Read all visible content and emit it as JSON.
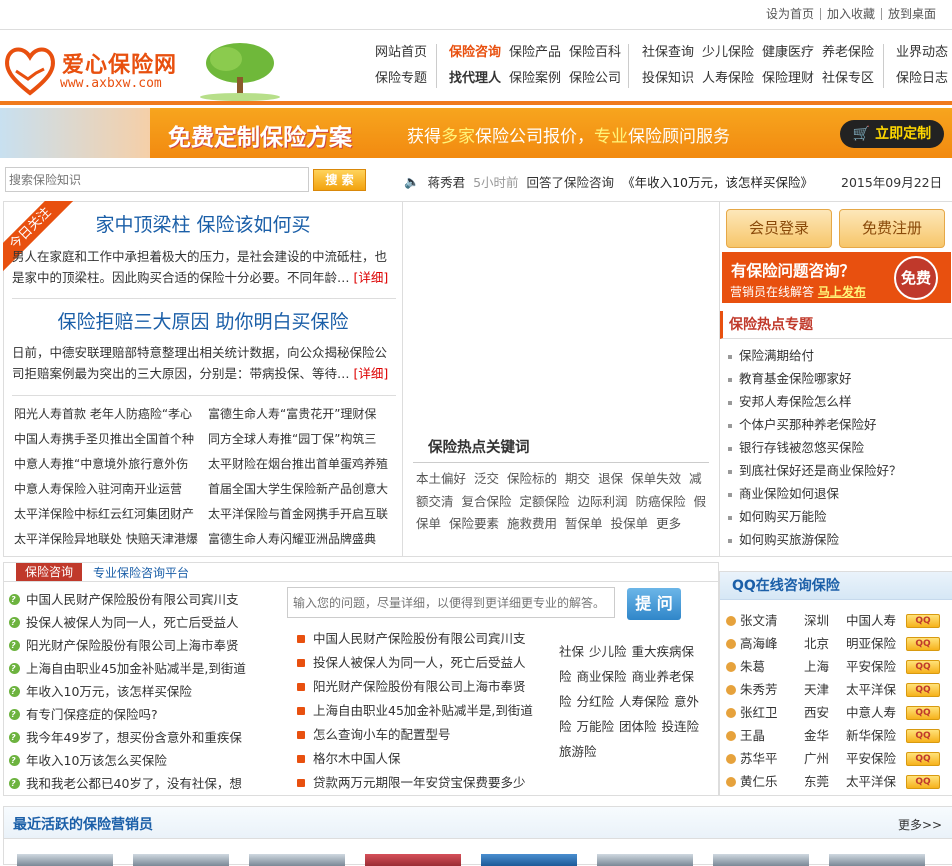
{
  "toplinks": [
    "设为首页",
    "加入收藏",
    "放到桌面"
  ],
  "logo": {
    "brand": "爱心保险网",
    "url": "www.axbxw.com"
  },
  "nav": {
    "g1": {
      "r1": [
        "网站首页"
      ],
      "r2": [
        "保险专题"
      ]
    },
    "g2": {
      "r1": [
        "保险咨询",
        "保险产品",
        "保险百科"
      ],
      "r2": [
        "找代理人",
        "保险案例",
        "保险公司"
      ]
    },
    "g3": {
      "r1": [
        "社保查询",
        "少儿保险",
        "健康医疗",
        "养老保险"
      ],
      "r2": [
        "投保知识",
        "人寿保险",
        "保险理财",
        "社保专区"
      ]
    },
    "g4": {
      "r1": [
        "业界动态"
      ],
      "r2": [
        "保险日志"
      ]
    }
  },
  "banner": {
    "t1": "免费定制保险方案",
    "t2a": "获得",
    "t2b": "多家",
    "t2c": "保险公司报价，",
    "t2d": "专业",
    "t2e": "保险顾问服务",
    "cta": "立即定制"
  },
  "search": {
    "placeholder": "搜索保险知识",
    "button": "搜 索"
  },
  "ticker": {
    "user": "蒋秀君",
    "time": "5小时前",
    "action": "回答了保险咨询",
    "question": "《年收入10万元，该怎样买保险》"
  },
  "date": "2015年09月22日",
  "focus": {
    "ribbon": "今日关注",
    "h1": "家中顶梁柱  保险该如何买",
    "p1": "男人在家庭和工作中承担着极大的压力，是社会建设的中流砥柱，也是家中的顶梁柱。因此购买合适的保险十分必要。不同年龄…",
    "h2": "保险拒赔三大原因  助你明白买保险",
    "p2": "日前，中德安联理赔部特意整理出相关统计数据，向公众揭秘保险公司拒赔案例最为突出的三大原因，分别是：带病投保、等待…",
    "more": "[详细]",
    "news": [
      [
        "阳光人寿首款 老年人防癌险“孝心",
        "富德生命人寿“富贵花开”理财保"
      ],
      [
        "中国人寿携手圣贝推出全国首个种",
        "同方全球人寿推“园丁保”构筑三"
      ],
      [
        "中意人寿推“中意境外旅行意外伤",
        "太平财险在烟台推出首单蛋鸡养殖"
      ],
      [
        "中意人寿保险入驻河南开业运营",
        "首届全国大学生保险新产品创意大"
      ],
      [
        "太平洋保险中标红云红河集团财产",
        "太平洋保险与首金网携手开启互联"
      ],
      [
        "太平洋保险异地联处 快赔天津港爆",
        "富德生命人寿闪耀亚洲品牌盛典"
      ]
    ]
  },
  "keywords": {
    "title": "保险热点关键词",
    "items": [
      "本土偏好",
      "泛交",
      "保险标的",
      "期交",
      "退保",
      "保单失效",
      "减额交清",
      "复合保险",
      "定额保险",
      "边际利润",
      "防癌保险",
      "假保单",
      "保险要素",
      "施救费用",
      "暂保单",
      "投保单",
      "更多"
    ]
  },
  "right": {
    "login": "会员登录",
    "register": "免费注册",
    "ad": {
      "a1": "有保险问题咨询？",
      "a2": "营销员在线解答",
      "a3": "马上发布",
      "free": "免费"
    },
    "hot_title": "保险热点专题",
    "hot": [
      "保险满期给付",
      "教育基金保险哪家好",
      "安邦人寿保险怎么样",
      "个体户买那种养老保险好",
      "银行存钱被忽悠买保险",
      "到底社保好还是商业保险好？",
      "商业保险如何退保",
      "如何购买万能险",
      "如何购买旅游保险"
    ]
  },
  "consult": {
    "tag": "保险咨询",
    "sub": "专业保险咨询平台",
    "left": [
      "中国人民财产保险股份有限公司宾川支",
      "投保人被保人为同一人，死亡后受益人",
      "阳光财产保险股份有限公司上海市奉贤",
      "上海自由职业45加金补贴减半是,到街道",
      "年收入10万元，该怎样买保险",
      "有专门保痉症的保险吗?",
      "我今年49岁了，想买份含意外和重疾保",
      "年收入10万该怎么买保险",
      "我和我老公都已40岁了，没有社保，想"
    ],
    "ask_placeholder": "输入您的问题，尽量详细，以便得到更详细更专业的解答。",
    "ask_button": "提 问",
    "mid": [
      "中国人民财产保险股份有限公司宾川支",
      "投保人被保人为同一人，死亡后受益人",
      "阳光财产保险股份有限公司上海市奉贤",
      "上海自由职业45加金补贴减半是,到街道",
      "怎么查询小车的配置型号",
      "格尔木中国人保",
      "贷款两万元期限一年安贷宝保费要多少"
    ],
    "tags": [
      "社保",
      "少儿险",
      "重大疾病保险",
      "商业保险",
      "商业养老保险",
      "分红险",
      "人寿保险",
      "意外险",
      "万能险",
      "团体险",
      "投连险",
      "旅游险"
    ]
  },
  "qq": {
    "title": "QQ在线咨询保险",
    "badge": "QQ",
    "rows": [
      [
        "张文清",
        "深圳",
        "中国人寿"
      ],
      [
        "高海峰",
        "北京",
        "明亚保险"
      ],
      [
        "朱葛",
        "上海",
        "平安保险"
      ],
      [
        "朱秀芳",
        "天津",
        "太平洋保"
      ],
      [
        "张红卫",
        "西安",
        "中意人寿"
      ],
      [
        "王晶",
        "金华",
        "新华保险"
      ],
      [
        "苏华平",
        "广州",
        "平安保险"
      ],
      [
        "黄仁乐",
        "东莞",
        "太平洋保"
      ]
    ]
  },
  "recent": {
    "title": "最近活跃的保险营销员",
    "more": "更多>>"
  }
}
